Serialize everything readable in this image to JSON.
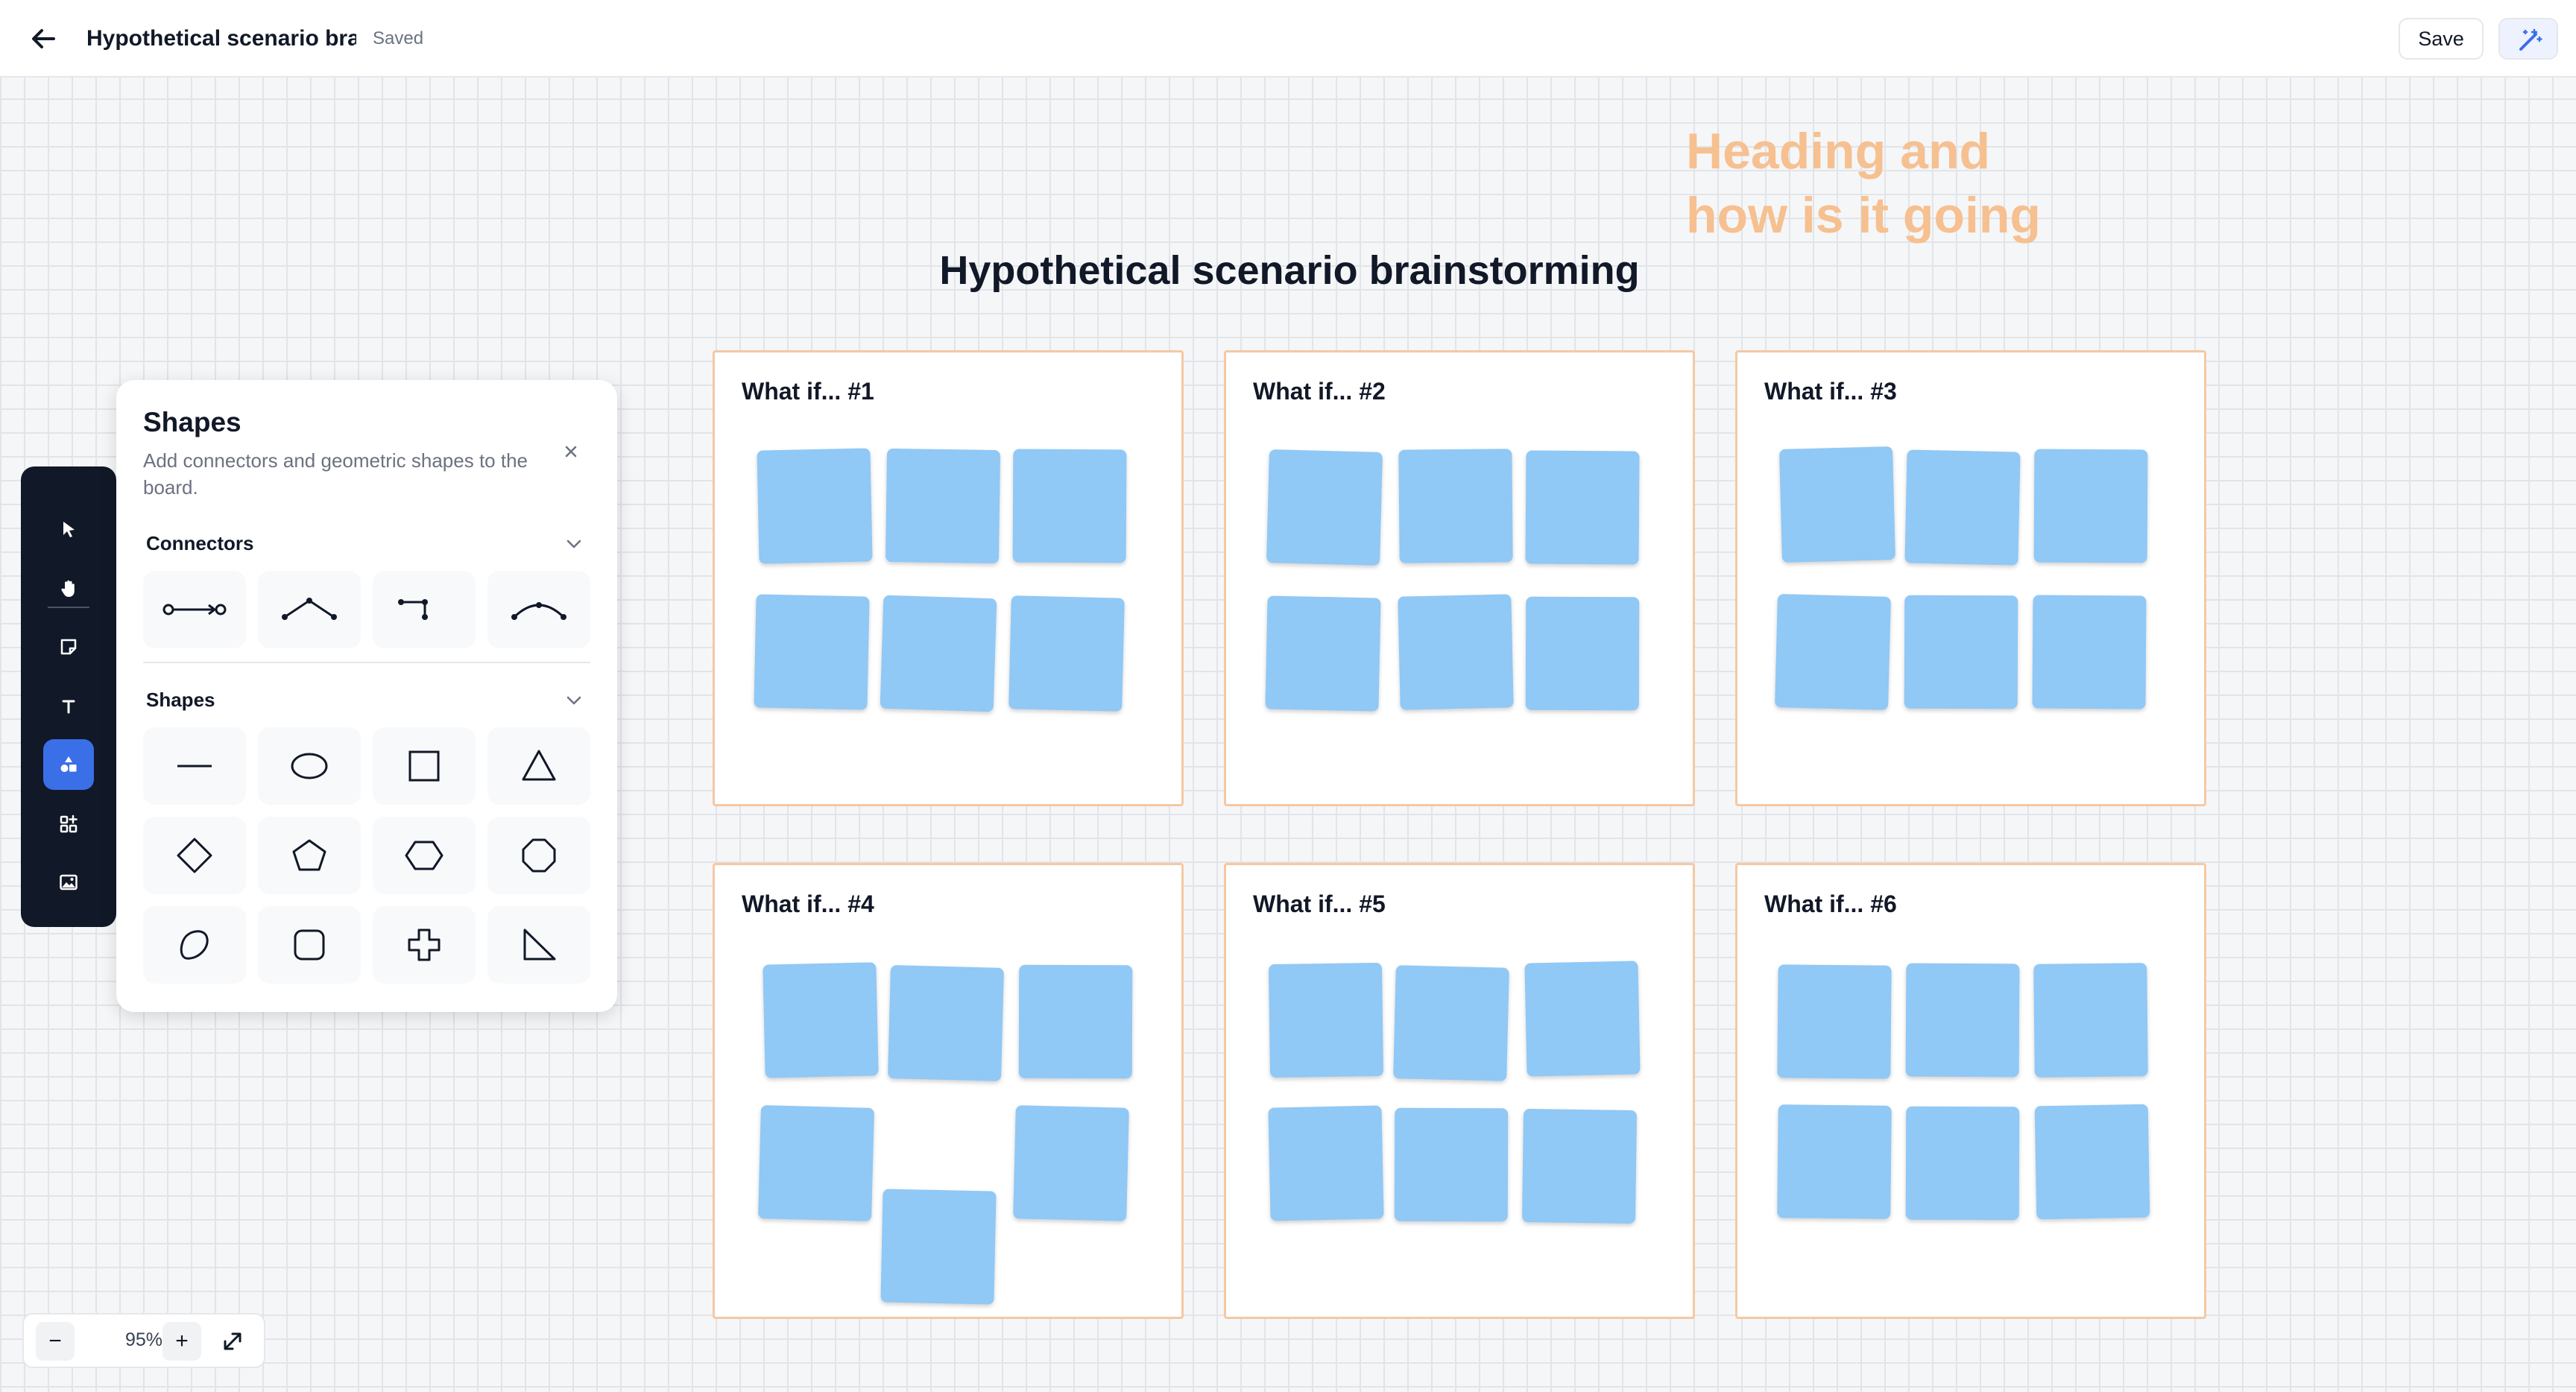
{
  "header": {
    "title": "Hypothetical scenario bra",
    "status": "Saved",
    "save_label": "Save"
  },
  "board": {
    "accent_heading": [
      "Heading and",
      "how is it going"
    ],
    "heading": "Hypothetical scenario brainstorming",
    "frames": [
      {
        "title": "What if... #1",
        "notes": 6
      },
      {
        "title": "What if... #2",
        "notes": 6
      },
      {
        "title": "What if... #3",
        "notes": 6
      },
      {
        "title": "What if... #4",
        "notes": 6
      },
      {
        "title": "What if... #5",
        "notes": 6
      },
      {
        "title": "What if... #6",
        "notes": 6
      }
    ]
  },
  "toolbar": {
    "tools": [
      "select-icon",
      "hand-icon",
      "sticky-note-icon",
      "text-icon",
      "shapes-icon",
      "widgets-icon",
      "image-icon"
    ],
    "active": "shapes-icon"
  },
  "shapes_panel": {
    "title": "Shapes",
    "description": "Add connectors and geometric shapes to the board.",
    "connectors_label": "Connectors",
    "connectors": [
      "straight-connector-icon",
      "angled-connector-icon",
      "elbow-connector-icon",
      "curved-connector-icon"
    ],
    "shapes_label": "Shapes",
    "shapes": [
      "line-icon",
      "ellipse-icon",
      "square-icon",
      "triangle-icon",
      "diamond-icon",
      "pentagon-icon",
      "hexagon-icon",
      "octagon-icon",
      "blob-icon",
      "rounded-square-icon",
      "cross-icon",
      "right-triangle-icon"
    ]
  },
  "zoom": {
    "minus": "−",
    "value": "95%",
    "plus": "+"
  },
  "colors": {
    "sticky_note": "#90c8f6",
    "frame_border": "#f5c8a3",
    "accent_heading": "#f6c090",
    "active_tool": "#3b6fe8",
    "toolbar_bg": "#111827"
  }
}
